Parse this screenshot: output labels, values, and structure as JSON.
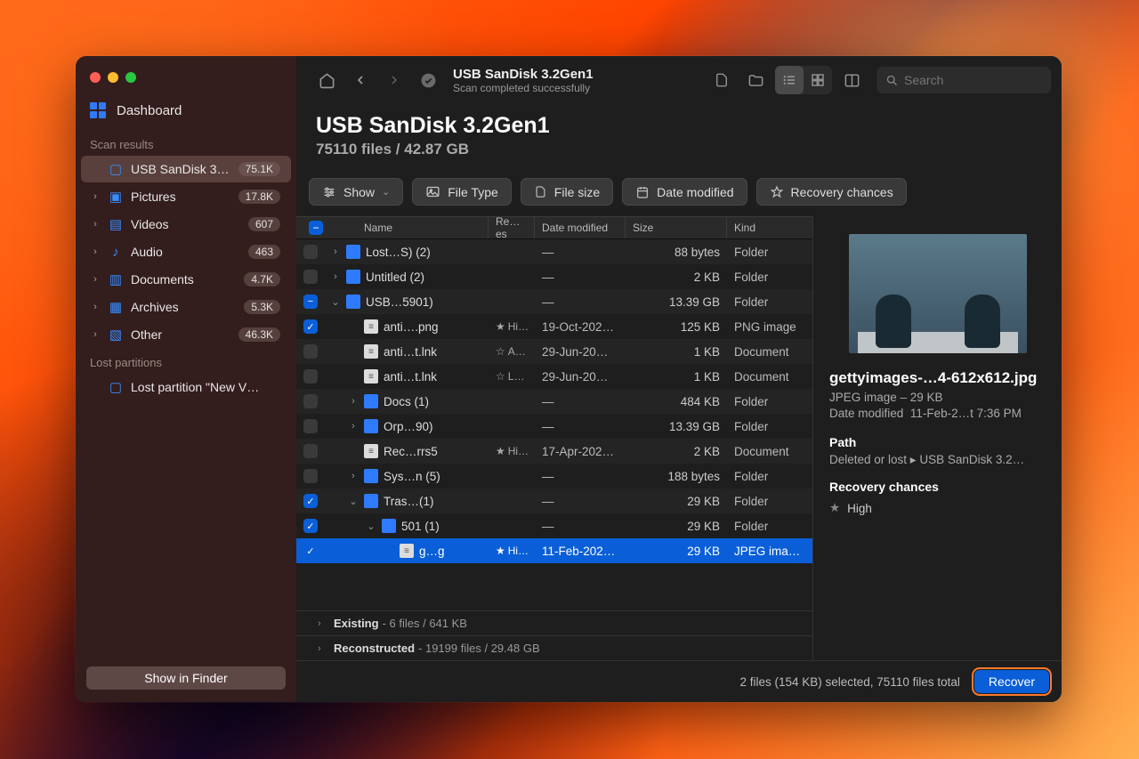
{
  "sidebar": {
    "dashboard": "Dashboard",
    "section_scan": "Scan results",
    "items": [
      {
        "label": "USB  SanDisk 3.…",
        "badge": "75.1K",
        "icon": "drive",
        "active": true,
        "chev": false
      },
      {
        "label": "Pictures",
        "badge": "17.8K",
        "icon": "picture",
        "chev": true
      },
      {
        "label": "Videos",
        "badge": "607",
        "icon": "video",
        "chev": true
      },
      {
        "label": "Audio",
        "badge": "463",
        "icon": "audio",
        "chev": true
      },
      {
        "label": "Documents",
        "badge": "4.7K",
        "icon": "doc",
        "chev": true
      },
      {
        "label": "Archives",
        "badge": "5.3K",
        "icon": "archive",
        "chev": true
      },
      {
        "label": "Other",
        "badge": "46.3K",
        "icon": "other",
        "chev": true
      }
    ],
    "section_lost": "Lost partitions",
    "lost_item": "Lost partition \"New V…",
    "show_finder": "Show in Finder"
  },
  "toolbar": {
    "title": "USB  SanDisk 3.2Gen1",
    "subtitle": "Scan completed successfully",
    "search_placeholder": "Search"
  },
  "header": {
    "title": "USB  SanDisk 3.2Gen1",
    "subtitle": "75110 files / 42.87 GB"
  },
  "filters": {
    "show": "Show",
    "filetype": "File Type",
    "filesize": "File size",
    "datemod": "Date modified",
    "recchance": "Recovery chances"
  },
  "columns": {
    "name": "Name",
    "rc": "Re…es",
    "dm": "Date modified",
    "sz": "Size",
    "kd": "Kind"
  },
  "rows": [
    {
      "chk": "",
      "disc": "›",
      "indent": 1,
      "icon": "folder",
      "name": "Lost…S) (2)",
      "rc": "",
      "rclabel": "",
      "dm": "—",
      "sz": "88 bytes",
      "kd": "Folder"
    },
    {
      "chk": "",
      "disc": "›",
      "indent": 1,
      "icon": "folder",
      "name": "Untitled (2)",
      "rc": "",
      "rclabel": "",
      "dm": "—",
      "sz": "2 KB",
      "kd": "Folder"
    },
    {
      "chk": "partial",
      "disc": "⌄",
      "indent": 1,
      "icon": "folder",
      "name": "USB…5901)",
      "rc": "",
      "rclabel": "",
      "dm": "—",
      "sz": "13.39 GB",
      "kd": "Folder"
    },
    {
      "chk": "on",
      "disc": "",
      "indent": 2,
      "icon": "file",
      "name": "anti….png",
      "rc": "★",
      "rclabel": "Hi…",
      "dm": "19-Oct-202…",
      "sz": "125 KB",
      "kd": "PNG image"
    },
    {
      "chk": "",
      "disc": "",
      "indent": 2,
      "icon": "file",
      "name": "anti…t.lnk",
      "rc": "☆",
      "rclabel": "A…",
      "dm": "29-Jun-20…",
      "sz": "1 KB",
      "kd": "Document"
    },
    {
      "chk": "",
      "disc": "",
      "indent": 2,
      "icon": "file",
      "name": "anti…t.lnk",
      "rc": "☆",
      "rclabel": "L…",
      "dm": "29-Jun-20…",
      "sz": "1 KB",
      "kd": "Document"
    },
    {
      "chk": "",
      "disc": "›",
      "indent": 2,
      "icon": "folder",
      "name": "Docs (1)",
      "rc": "",
      "rclabel": "",
      "dm": "—",
      "sz": "484 KB",
      "kd": "Folder"
    },
    {
      "chk": "",
      "disc": "›",
      "indent": 2,
      "icon": "folder",
      "name": "Orp…90)",
      "rc": "",
      "rclabel": "",
      "dm": "—",
      "sz": "13.39 GB",
      "kd": "Folder"
    },
    {
      "chk": "",
      "disc": "",
      "indent": 2,
      "icon": "file",
      "name": "Rec…rrs5",
      "rc": "★",
      "rclabel": "Hi…",
      "dm": "17-Apr-202…",
      "sz": "2 KB",
      "kd": "Document"
    },
    {
      "chk": "",
      "disc": "›",
      "indent": 2,
      "icon": "folder",
      "name": "Sys…n (5)",
      "rc": "",
      "rclabel": "",
      "dm": "—",
      "sz": "188 bytes",
      "kd": "Folder"
    },
    {
      "chk": "on",
      "disc": "⌄",
      "indent": 2,
      "icon": "folder",
      "name": "Tras…(1)",
      "rc": "",
      "rclabel": "",
      "dm": "—",
      "sz": "29 KB",
      "kd": "Folder"
    },
    {
      "chk": "on",
      "disc": "⌄",
      "indent": 3,
      "icon": "folder",
      "name": "501 (1)",
      "rc": "",
      "rclabel": "",
      "dm": "—",
      "sz": "29 KB",
      "kd": "Folder"
    },
    {
      "chk": "on",
      "disc": "",
      "indent": 4,
      "icon": "file",
      "name": "g…g",
      "rc": "★",
      "rclabel": "Hi…",
      "dm": "11-Feb-202…",
      "sz": "29 KB",
      "kd": "JPEG ima…",
      "selected": true
    }
  ],
  "summaries": [
    {
      "label": "Existing",
      "info": "6 files / 641 KB"
    },
    {
      "label": "Reconstructed",
      "info": "19199 files / 29.48 GB"
    }
  ],
  "status": {
    "text": "2 files (154 KB) selected, 75110 files total",
    "recover": "Recover"
  },
  "details": {
    "filename": "gettyimages-…4-612x612.jpg",
    "meta1": "JPEG image – 29 KB",
    "meta2_label": "Date modified",
    "meta2_val": "11-Feb-2…t 7:36 PM",
    "path_label": "Path",
    "path_val": "Deleted or lost ▸ USB  SanDisk 3.2…",
    "rc_label": "Recovery chances",
    "rc_val": "High"
  }
}
